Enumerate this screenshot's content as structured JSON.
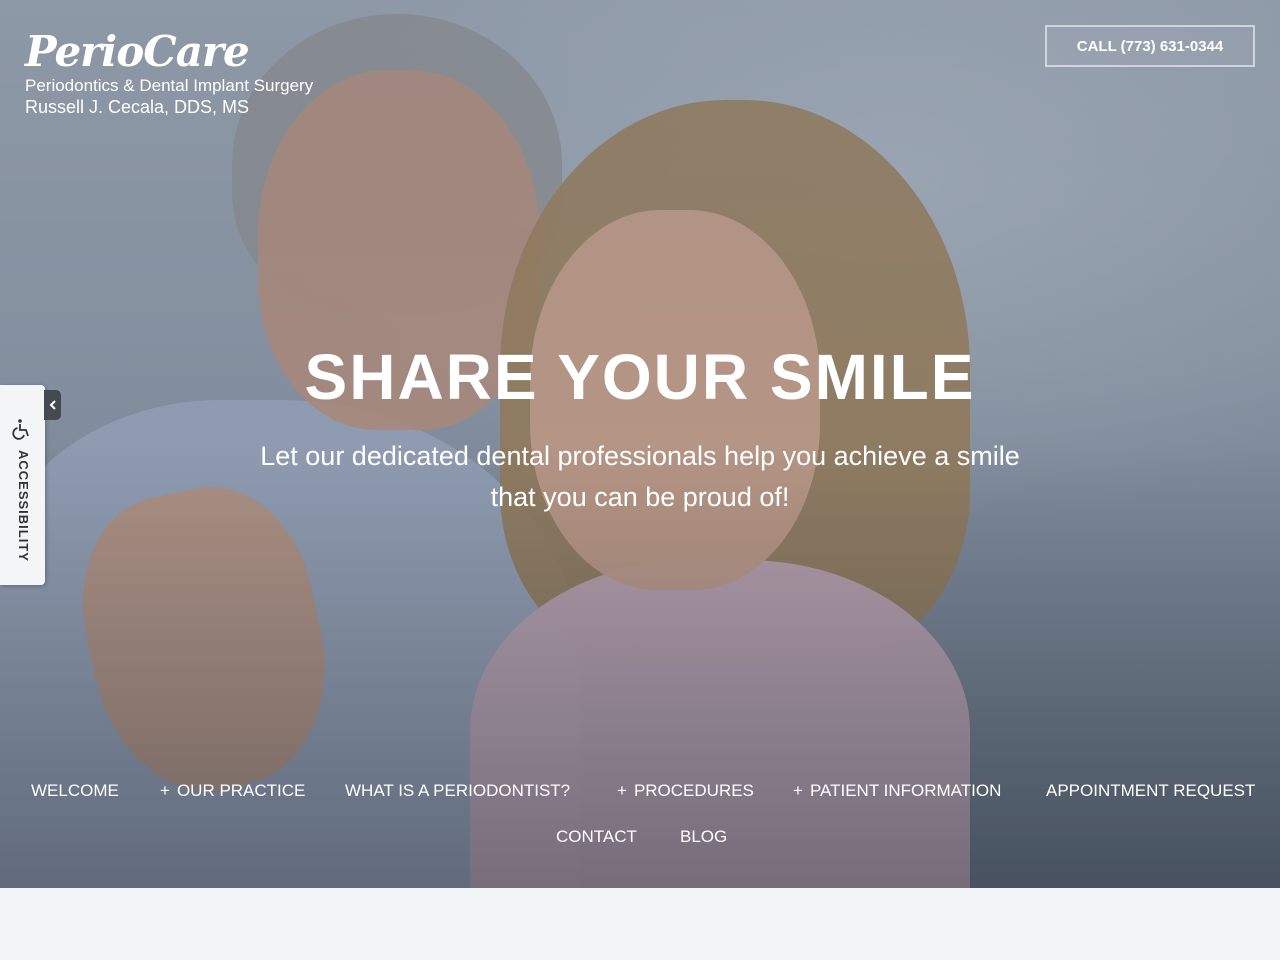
{
  "brand": {
    "name": "PerioCare",
    "tagline": "Periodontics & Dental Implant Surgery",
    "doctor": "Russell J. Cecala, DDS, MS"
  },
  "header": {
    "call_label": "CALL (773) 631-0344"
  },
  "hero": {
    "headline": "SHARE YOUR SMILE",
    "subhead_line1": "Let our dedicated dental professionals help you achieve a smile",
    "subhead_line2": "that you can be proud of!"
  },
  "nav": {
    "items": [
      {
        "label": "WELCOME",
        "has_submenu": false
      },
      {
        "label": "OUR PRACTICE",
        "has_submenu": true
      },
      {
        "label": "WHAT IS A PERIODONTIST?",
        "has_submenu": false
      },
      {
        "label": "PROCEDURES",
        "has_submenu": true
      },
      {
        "label": "PATIENT INFORMATION",
        "has_submenu": true
      },
      {
        "label": "APPOINTMENT REQUEST",
        "has_submenu": false
      },
      {
        "label": "CONTACT",
        "has_submenu": false
      },
      {
        "label": "BLOG",
        "has_submenu": false
      }
    ],
    "submenu_marker": "+"
  },
  "accessibility": {
    "label": "ACCESSIBILITY",
    "icon": "wheelchair-icon",
    "toggle_icon": "chevron-left-icon"
  },
  "colors": {
    "text_on_hero": "#ffffff",
    "page_background": "#f1f4f7",
    "a11y_tab": "#f4f5f6",
    "a11y_toggle": "#454a50"
  }
}
